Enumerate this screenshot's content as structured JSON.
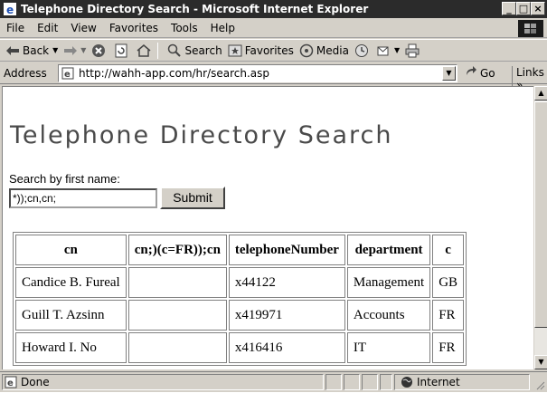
{
  "window": {
    "title": "Telephone Directory Search - Microsoft Internet Explorer",
    "minimize": "_",
    "maximize": "□",
    "close": "×"
  },
  "menu": {
    "items": [
      {
        "label": "File"
      },
      {
        "label": "Edit"
      },
      {
        "label": "View"
      },
      {
        "label": "Favorites"
      },
      {
        "label": "Tools"
      },
      {
        "label": "Help"
      }
    ]
  },
  "toolbar": {
    "back": "Back",
    "search": "Search",
    "favorites": "Favorites",
    "media": "Media"
  },
  "address": {
    "label": "Address",
    "url": "http://wahh-app.com/hr/search.asp",
    "go": "Go",
    "links": "Links »"
  },
  "page": {
    "title": "Telephone Directory Search",
    "search_label": "Search by first name:",
    "search_value": "*));cn,cn;",
    "submit": "Submit"
  },
  "table": {
    "headers": [
      "cn",
      "cn;)(c=FR));cn",
      "telephoneNumber",
      "department",
      "c"
    ],
    "rows": [
      [
        "Candice B. Fureal",
        "",
        "x44122",
        "Management",
        "GB"
      ],
      [
        "Guill T. Azsinn",
        "",
        "x419971",
        "Accounts",
        "FR"
      ],
      [
        "Howard I. No",
        "",
        "x416416",
        "IT",
        "FR"
      ]
    ]
  },
  "status": {
    "text": "Done",
    "zone": "Internet"
  }
}
